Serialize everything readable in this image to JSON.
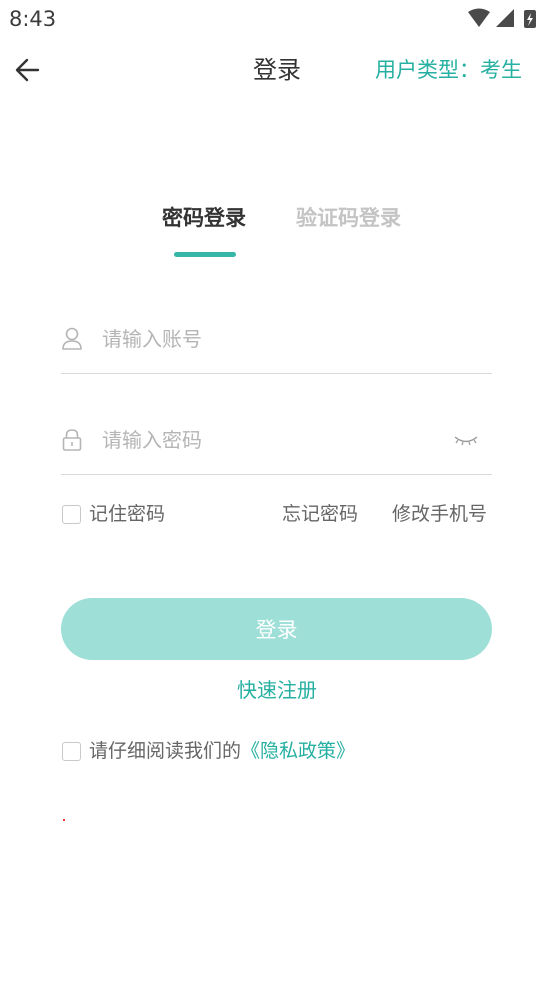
{
  "status_bar": {
    "time": "8:43"
  },
  "header": {
    "title": "登录",
    "user_type": "用户类型：考生"
  },
  "tabs": [
    {
      "label": "密码登录",
      "active": true
    },
    {
      "label": "验证码登录",
      "active": false
    }
  ],
  "form": {
    "account_placeholder": "请输入账号",
    "password_placeholder": "请输入密码"
  },
  "options": {
    "remember_label": "记住密码",
    "forgot_label": "忘记密码",
    "change_phone_label": "修改手机号"
  },
  "actions": {
    "login_label": "登录",
    "register_label": "快速注册"
  },
  "privacy": {
    "prefix": "请仔细阅读我们的",
    "link": "《隐私政策》"
  },
  "colors": {
    "accent": "#26b0a2",
    "login_button": "#9edfd7"
  }
}
